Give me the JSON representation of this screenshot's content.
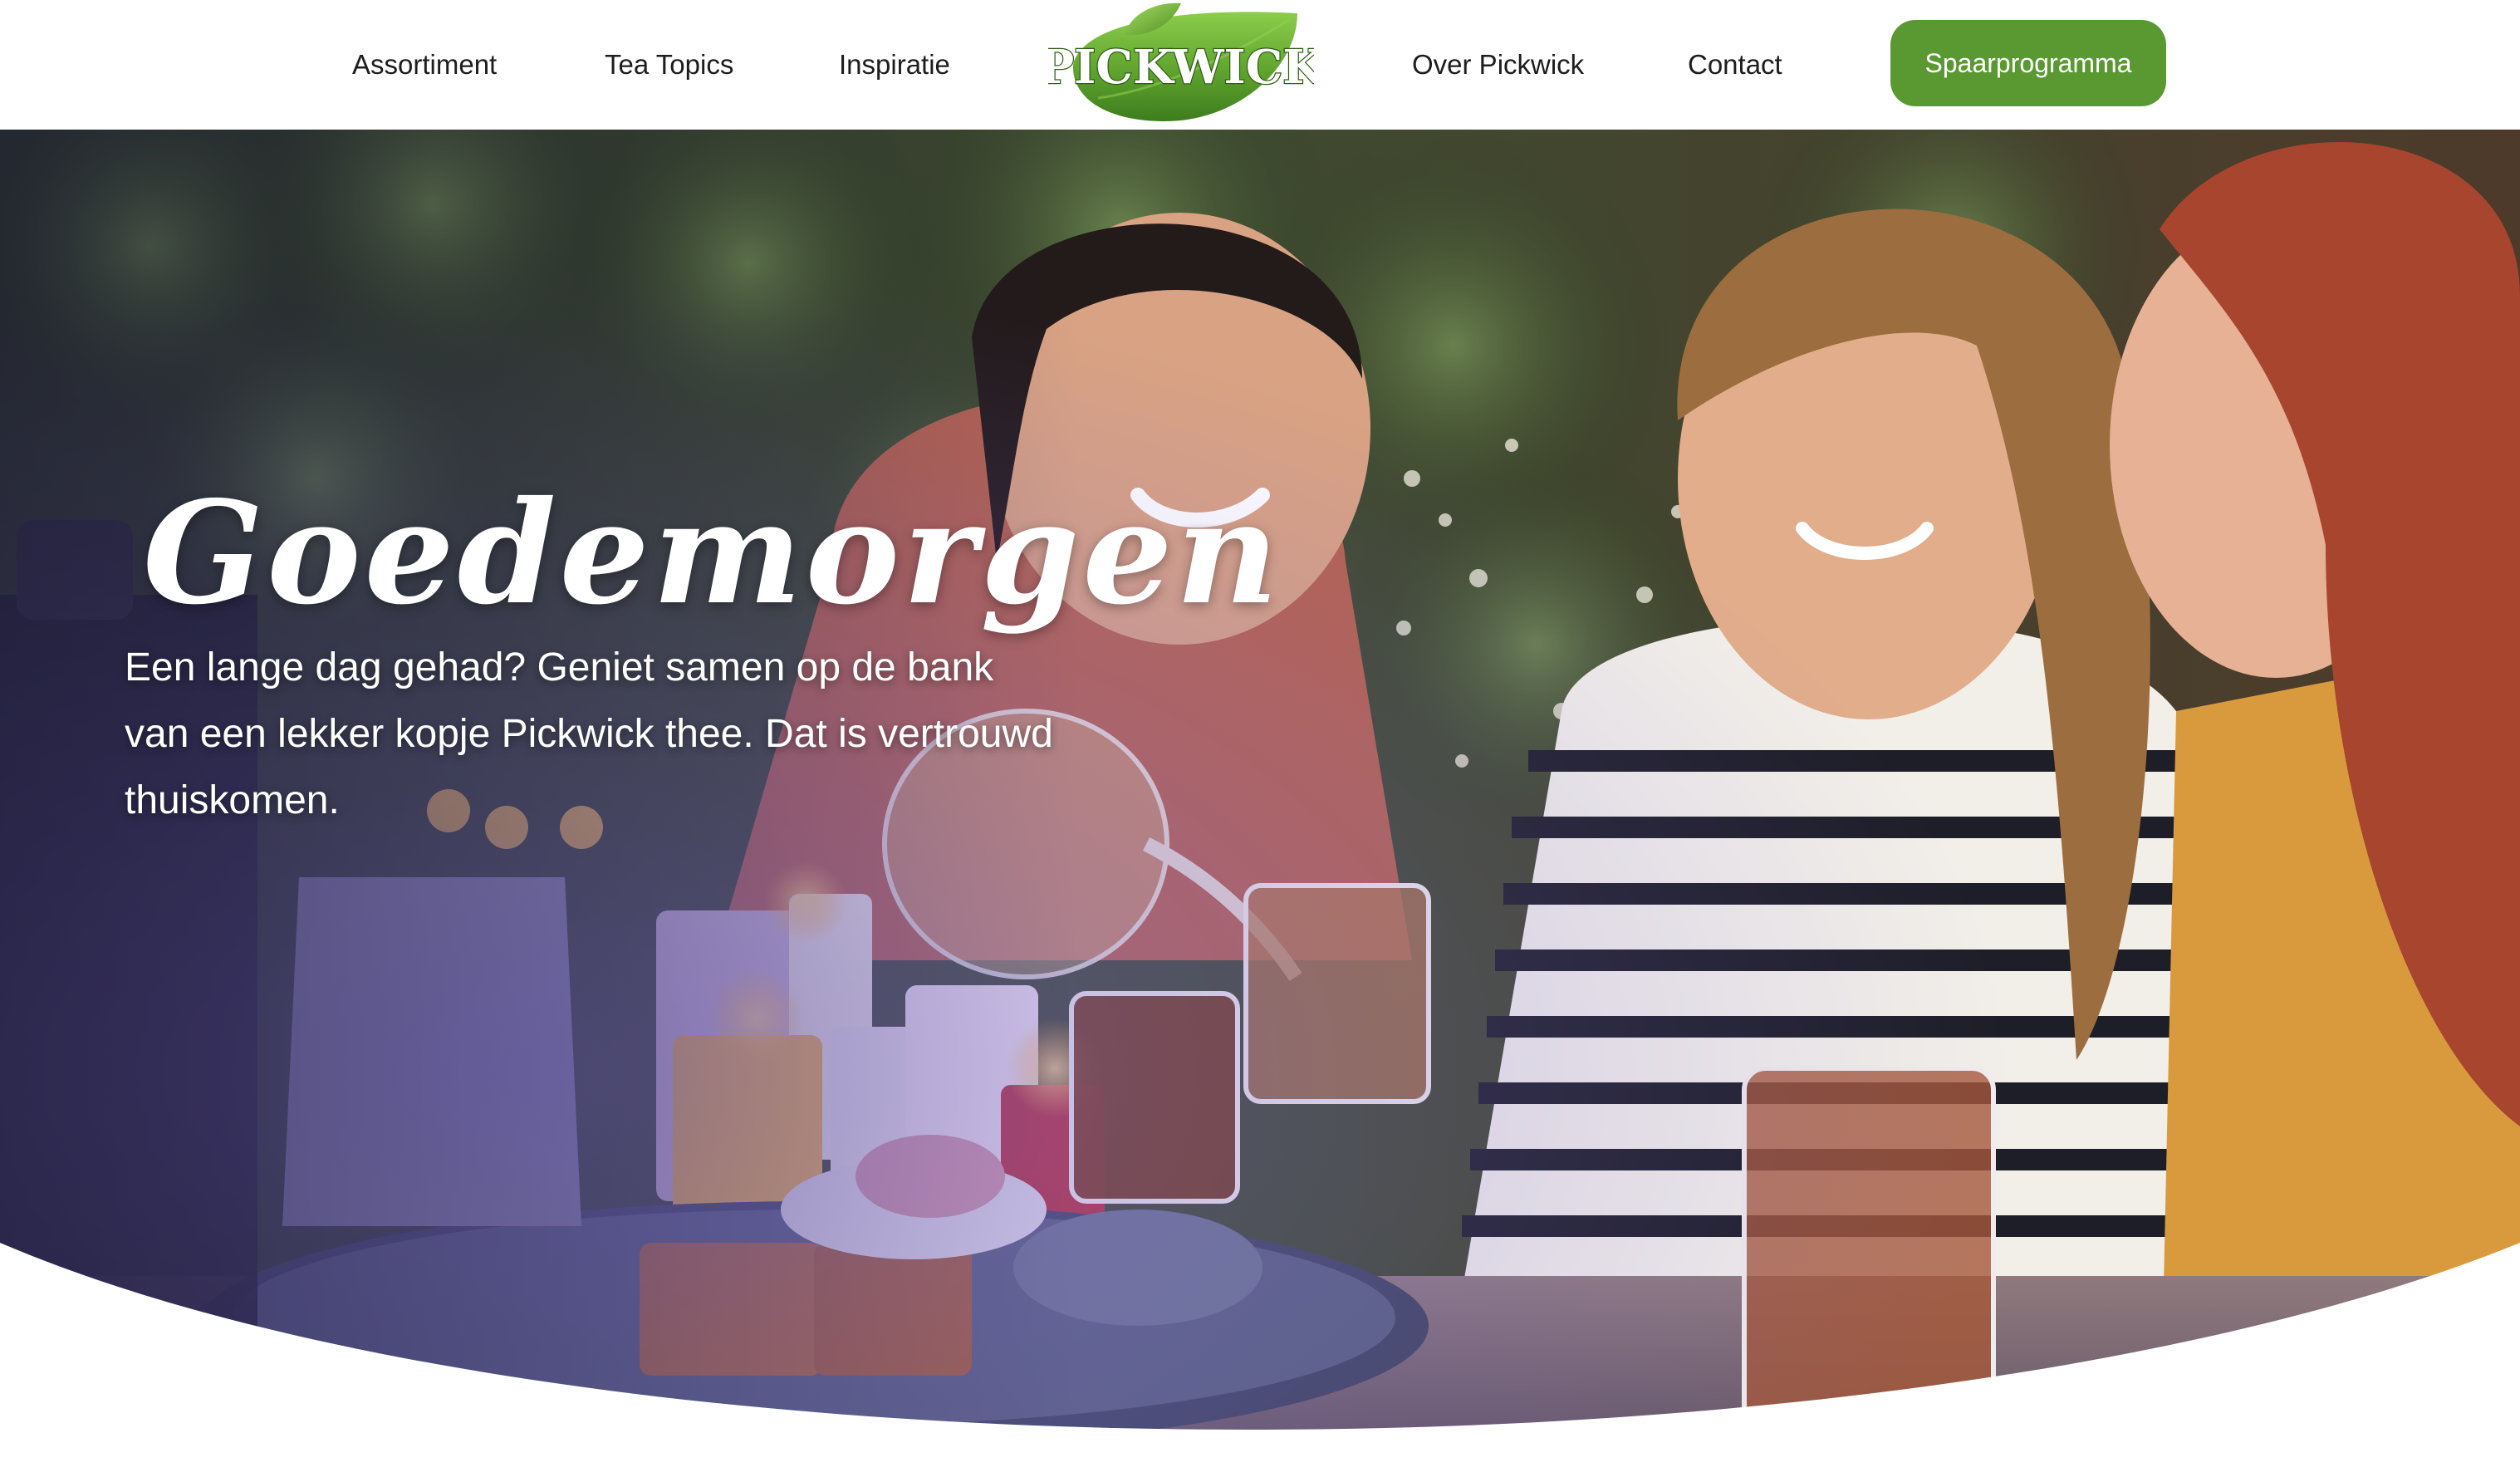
{
  "nav": {
    "items": [
      {
        "label": "Assortiment"
      },
      {
        "label": "Tea Topics"
      },
      {
        "label": "Inspiratie"
      },
      {
        "label": "Over Pickwick"
      },
      {
        "label": "Contact"
      }
    ],
    "cta_label": "Spaarprogramma"
  },
  "logo": {
    "text": "PICKWICK",
    "icon": "pickwick-leaf-logo-icon"
  },
  "hero": {
    "title": "Goedemorgen",
    "text": "Een lange dag gehad? Geniet samen op de bank van een lekker kopje Pickwick thee. Dat is vertrouwd thuiskomen."
  },
  "colors": {
    "brand_green": "#5e9a2f",
    "cta_green": "#5a9932",
    "nav_text": "#1d1d1d",
    "hero_text": "#ffffff"
  }
}
